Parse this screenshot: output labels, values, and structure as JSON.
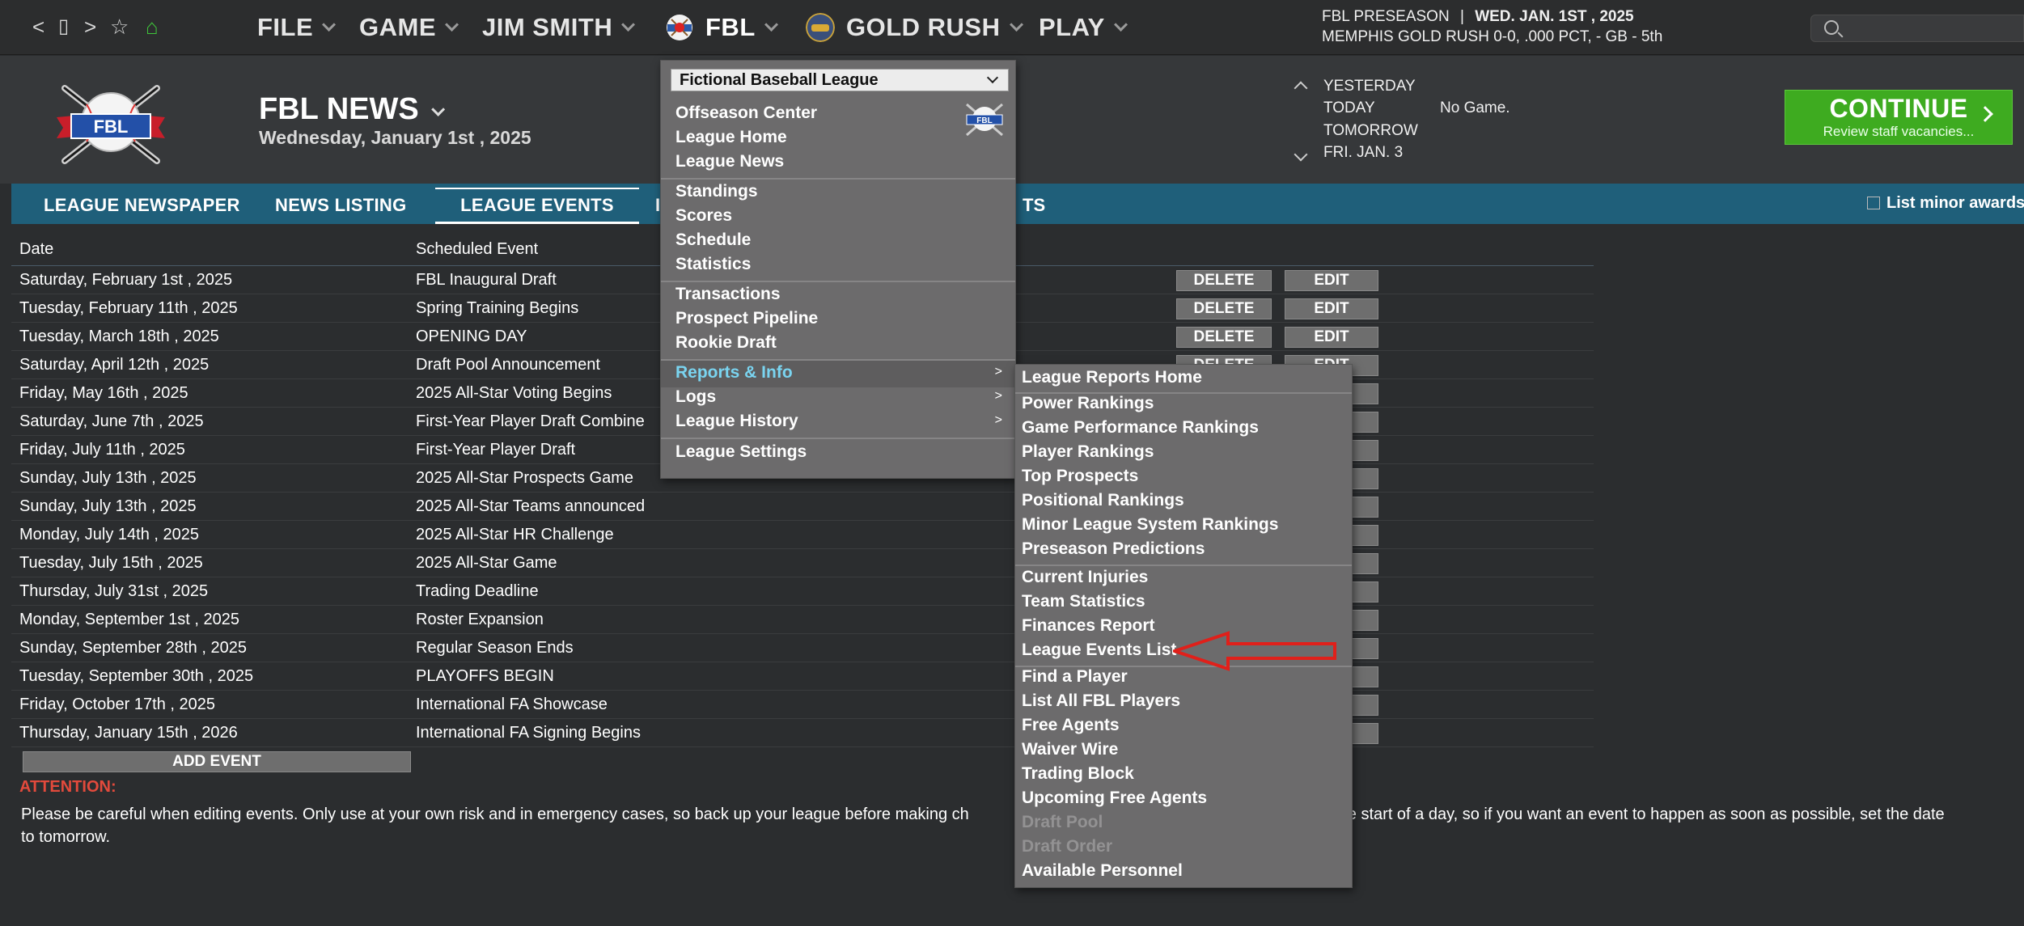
{
  "nav": {
    "back": "<",
    "page": "▯",
    "forward": ">",
    "star": "☆",
    "home": "⌂",
    "menus": [
      "FILE",
      "GAME",
      "JIM SMITH",
      "FBL",
      "GOLD RUSH",
      "PLAY"
    ]
  },
  "status": {
    "line1_left": "FBL PRESEASON",
    "line1_sep": "|",
    "line1_right": "WED. JAN. 1ST , 2025",
    "line2": "MEMPHIS GOLD RUSH  0-0, .000 PCT, - GB - 5th"
  },
  "header": {
    "title": "FBL NEWS",
    "date": "Wednesday, January 1st , 2025",
    "logo_text": "FBL",
    "days": [
      "YESTERDAY",
      "TODAY",
      "TOMORROW",
      "FRI. JAN. 3"
    ],
    "no_game": "No Game.",
    "continue_label": "CONTINUE",
    "continue_sub": "Review staff vacancies..."
  },
  "tabs": {
    "items": [
      "LEAGUE NEWSPAPER",
      "NEWS LISTING",
      "LEAGUE EVENTS"
    ],
    "partial_left": "I",
    "partial_right": "TS",
    "minor_awards": "List minor awards"
  },
  "table": {
    "headers": [
      "Date",
      "Scheduled Event"
    ],
    "delete_label": "DELETE",
    "edit_label": "EDIT",
    "rows": [
      {
        "date": "Saturday, February 1st , 2025",
        "event": "FBL Inaugural Draft"
      },
      {
        "date": "Tuesday, February 11th , 2025",
        "event": "Spring Training Begins"
      },
      {
        "date": "Tuesday, March 18th , 2025",
        "event": "OPENING DAY"
      },
      {
        "date": "Saturday, April 12th , 2025",
        "event": "Draft Pool Announcement"
      },
      {
        "date": "Friday, May 16th , 2025",
        "event": "2025 All-Star Voting Begins"
      },
      {
        "date": "Saturday, June 7th , 2025",
        "event": "First-Year Player Draft Combine"
      },
      {
        "date": "Friday, July 11th , 2025",
        "event": "First-Year Player Draft"
      },
      {
        "date": "Sunday, July 13th , 2025",
        "event": "2025 All-Star Prospects Game"
      },
      {
        "date": "Sunday, July 13th , 2025",
        "event": "2025 All-Star Teams announced"
      },
      {
        "date": "Monday, July 14th , 2025",
        "event": "2025 All-Star HR Challenge"
      },
      {
        "date": "Tuesday, July 15th , 2025",
        "event": "2025 All-Star Game"
      },
      {
        "date": "Thursday, July 31st , 2025",
        "event": "Trading Deadline"
      },
      {
        "date": "Monday, September 1st , 2025",
        "event": "Roster Expansion"
      },
      {
        "date": "Sunday, September 28th , 2025",
        "event": "Regular Season Ends"
      },
      {
        "date": "Tuesday, September 30th , 2025",
        "event": "PLAYOFFS BEGIN"
      },
      {
        "date": "Friday, October 17th , 2025",
        "event": "International FA Showcase"
      },
      {
        "date": "Thursday, January 15th , 2026",
        "event": "International FA Signing Begins"
      }
    ],
    "add_event": "ADD EVENT"
  },
  "notice": {
    "attention": "ATTENTION:",
    "text_left": "Please be careful when editing events. Only use at your own risk and in emergency cases, so back up your league before making ch",
    "text_right": "t the start of a day, so if you want an event to happen as soon as possible, set the date",
    "text_line2": "to tomorrow."
  },
  "fbl_menu": {
    "select_value": "Fictional Baseball League",
    "items": [
      "Offseason Center",
      "League Home",
      "League News",
      "Standings",
      "Scores",
      "Schedule",
      "Statistics",
      "Transactions",
      "Prospect Pipeline",
      "Rookie Draft",
      "Reports & Info",
      "Logs",
      "League History",
      "League Settings"
    ],
    "submenu_arrow": ">"
  },
  "reports_menu": {
    "items": [
      "League Reports Home",
      "Power Rankings",
      "Game Performance Rankings",
      "Player Rankings",
      "Top Prospects",
      "Positional Rankings",
      "Minor League System Rankings",
      "Preseason Predictions",
      "Current Injuries",
      "Team Statistics",
      "Finances Report",
      "League Events List",
      "Find a Player",
      "List All FBL Players",
      "Free Agents",
      "Waiver Wire",
      "Trading Block",
      "Upcoming Free Agents",
      "Draft Pool",
      "Draft Order",
      "Available Personnel"
    ]
  },
  "colors": {
    "continue": "#3eab20",
    "tabbar": "#1f5f7a",
    "attention": "#e34a3c",
    "highlight_text": "#7ad4f0",
    "annotation_arrow": "#e0201a"
  }
}
